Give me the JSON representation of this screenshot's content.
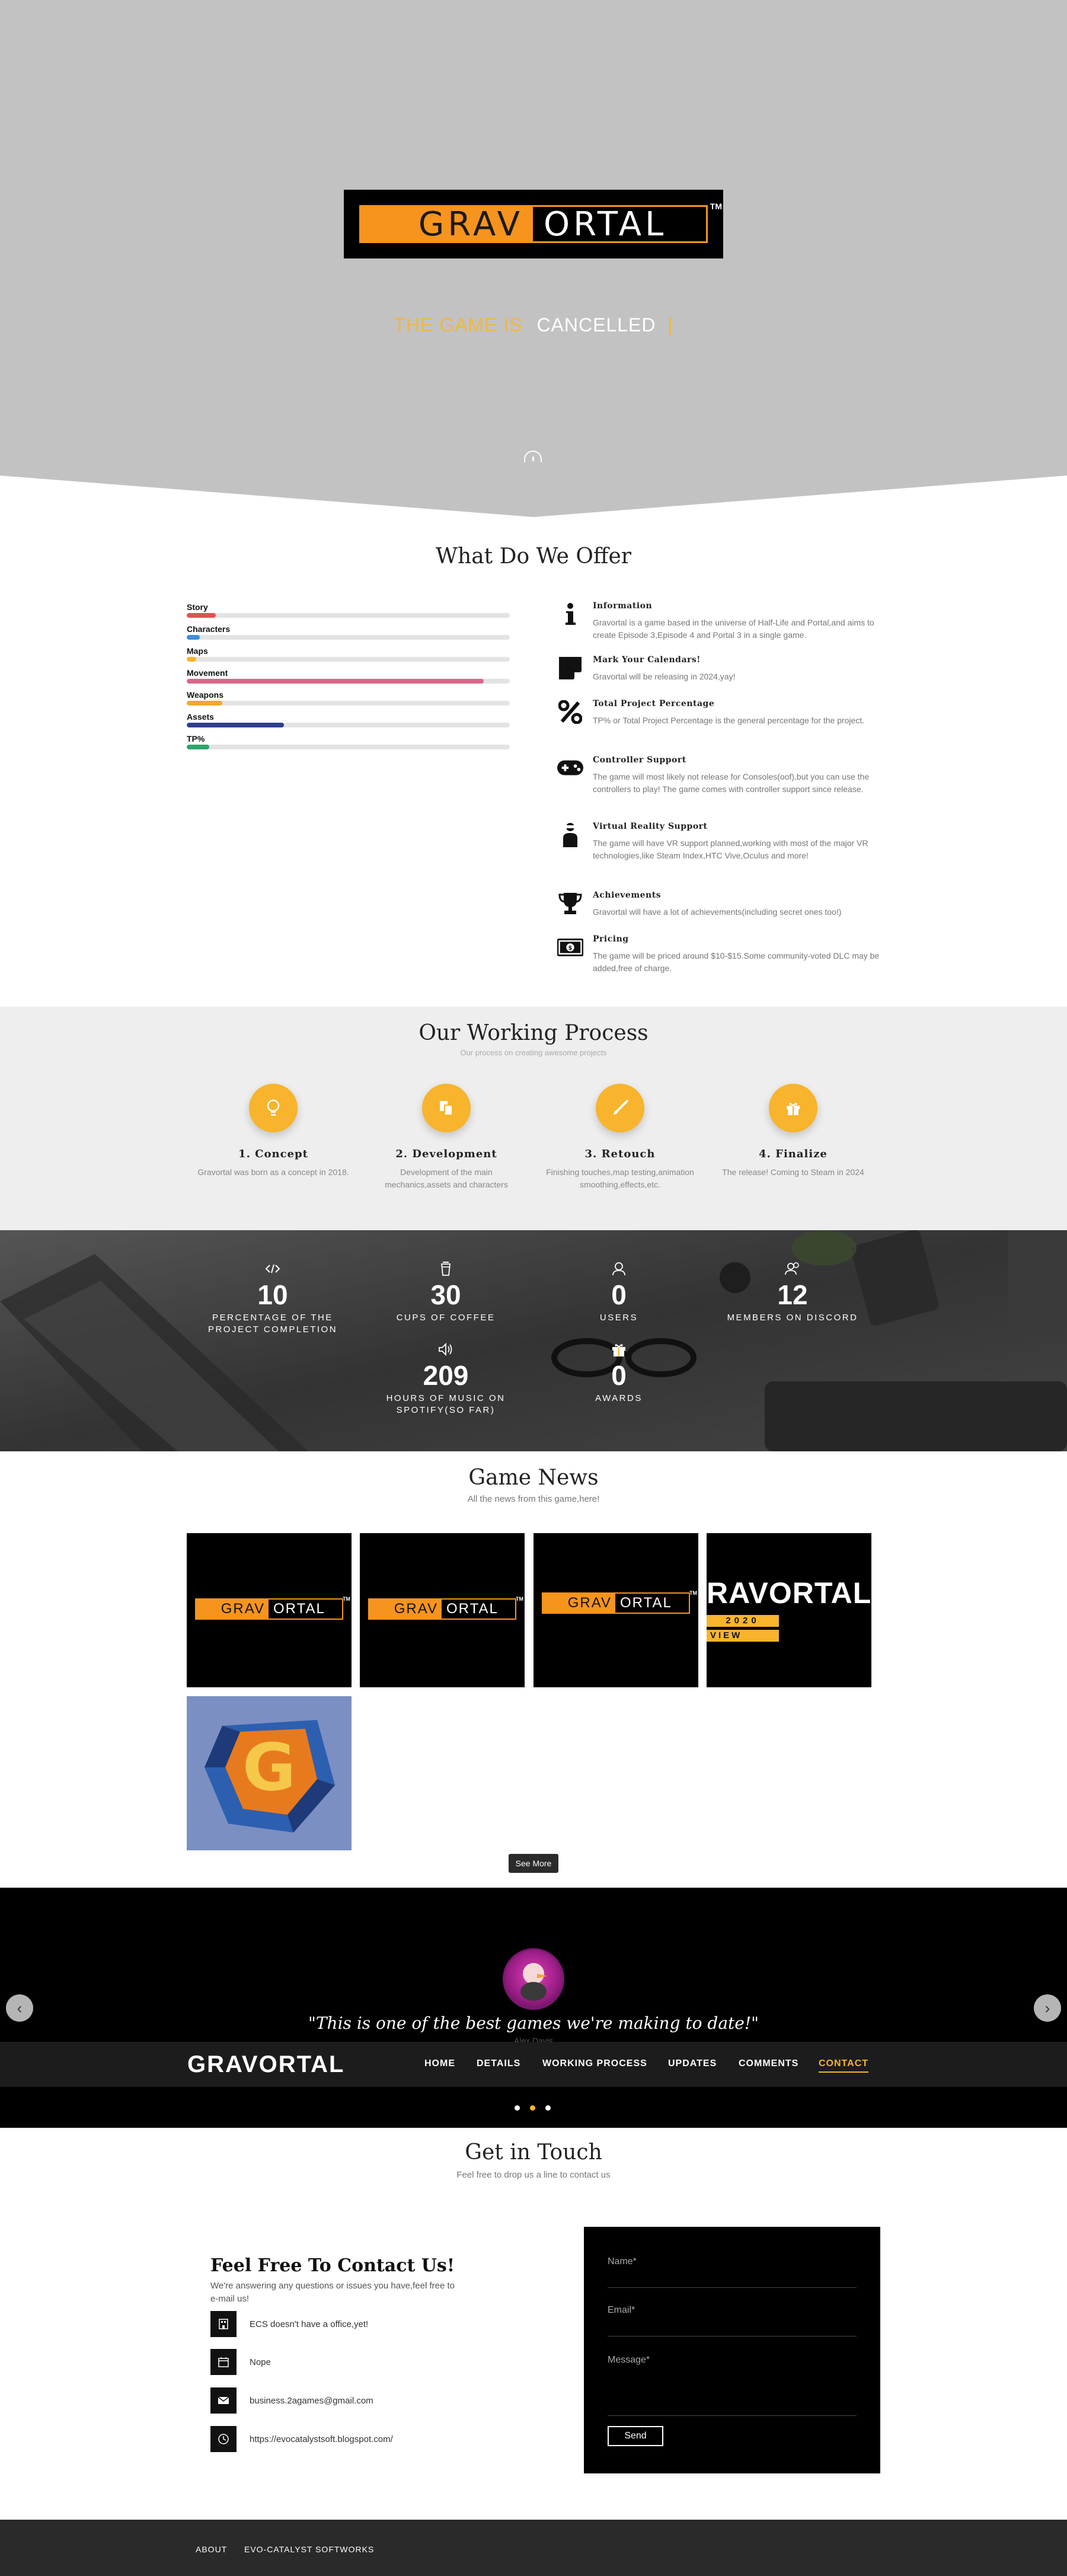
{
  "hero": {
    "logo_left": "GRAV",
    "logo_right": "ORTAL",
    "logo_tm": "TM",
    "tagline_prefix": "THE GAME IS",
    "tagline_word": "CANCELLED",
    "tagline_cursor": "|"
  },
  "offer": {
    "title": "What Do We Offer",
    "skills": [
      {
        "label": "Story",
        "percent": 9,
        "color": "#e0524f"
      },
      {
        "label": "Characters",
        "percent": 4,
        "color": "#3b8fd8"
      },
      {
        "label": "Maps",
        "percent": 3,
        "color": "#f7b42c"
      },
      {
        "label": "Movement",
        "percent": 92,
        "color": "#d8678a"
      },
      {
        "label": "Weapons",
        "percent": 11,
        "color": "#f0a92c"
      },
      {
        "label": "Assets",
        "percent": 30,
        "color": "#2f3f8f"
      },
      {
        "label": "TP%",
        "percent": 7,
        "color": "#2fa36b"
      }
    ],
    "features": [
      {
        "icon": "info-icon",
        "title": "Information",
        "text": "Gravortal is a game based in the universe of Half-Life and Portal,and aims to create Episode 3,Episode 4 and Portal 3 in a single game."
      },
      {
        "icon": "sticky-note-icon",
        "title": "Mark Your Calendars!",
        "text": "Gravortal will be releasing in 2024,yay!"
      },
      {
        "icon": "percent-icon",
        "title": "Total Project Percentage",
        "text": "TP% or Total Project Percentage is the general percentage for the project."
      },
      {
        "icon": "gamepad-icon",
        "title": "Controller Support",
        "text": "The game will most likely not release for Consoles(oof),but you can use the controllers to play! The game comes with controller support since release."
      },
      {
        "icon": "vr-user-icon",
        "title": "Virtual Reality Support",
        "text": "The game will have VR support planned,working with most of the major VR technologies,like Steam Index,HTC Vive,Oculus and more!"
      },
      {
        "icon": "trophy-icon",
        "title": "Achievements",
        "text": "Gravortal will have a lot of achievements(including secret ones too!)"
      },
      {
        "icon": "money-bill-icon",
        "title": "Pricing",
        "text": "The game will be priced around $10-$15.Some community-voted DLC may be added,free of charge."
      }
    ]
  },
  "process": {
    "title": "Our Working Process",
    "subtitle": "Our process on creating awesome projects",
    "steps": [
      {
        "icon": "lightbulb-icon",
        "title": "1. Concept",
        "text": "Gravortal was born as a concept in 2018."
      },
      {
        "icon": "copy-files-icon",
        "title": "2. Development",
        "text": "Development of the main mechanics,assets and characters"
      },
      {
        "icon": "brush-icon",
        "title": "3. Retouch",
        "text": "Finishing touches,map testing,animation smoothing,effects,etc."
      },
      {
        "icon": "gift-icon",
        "title": "4. Finalize",
        "text": "The release! Coming to Steam in 2024"
      }
    ]
  },
  "stats": [
    {
      "icon": "code-icon",
      "value": "10",
      "label": "PERCENTAGE OF THE PROJECT COMPLETION"
    },
    {
      "icon": "coffee-cup-icon",
      "value": "30",
      "label": "CUPS OF COFFEE"
    },
    {
      "icon": "user-icon",
      "value": "0",
      "label": "USERS"
    },
    {
      "icon": "users-icon",
      "value": "12",
      "label": "MEMBERS ON DISCORD"
    },
    {
      "icon": "speaker-icon",
      "value": "209",
      "label": "HOURS OF MUSIC ON SPOTIFY(SO FAR)"
    },
    {
      "icon": "gift-icon",
      "value": "0",
      "label": "AWARDS"
    }
  ],
  "news": {
    "title": "Game News",
    "subtitle": "All the news from this game,here!",
    "logo_left": "GRAV",
    "logo_right": "ORTAL",
    "tile4_word": "RAVORTAL",
    "tile4_year": "2020",
    "tile4_sub": "VIEW",
    "see_more": "See More"
  },
  "testimonial": {
    "quote": "\"This is one of the best games we're making to date!\"",
    "author": "Alex Davis"
  },
  "nav": {
    "brand": "GRAVORTAL",
    "items": [
      "HOME",
      "DETAILS",
      "WORKING PROCESS",
      "UPDATES",
      "COMMENTS",
      "CONTACT"
    ]
  },
  "contact": {
    "title": "Get in Touch",
    "subtitle": "Feel free to drop us a line to contact us",
    "heading": "Feel Free To Contact Us!",
    "intro": "We're answering any questions or issues you have,feel free to e-mail us!",
    "rows": [
      {
        "icon": "building-icon",
        "text": "ECS doesn't have a office,yet!"
      },
      {
        "icon": "calendar-icon",
        "text": "Nope"
      },
      {
        "icon": "envelope-icon",
        "text": "business.2agames@gmail.com"
      },
      {
        "icon": "globe-icon",
        "text": "https://evocatalystsoft.blogspot.com/"
      }
    ],
    "form": {
      "name": "Name*",
      "email": "Email*",
      "message": "Message*",
      "send": "Send"
    }
  },
  "footer": {
    "links": [
      "ABOUT",
      "EVO-CATALYST SOFTWORKS"
    ]
  }
}
